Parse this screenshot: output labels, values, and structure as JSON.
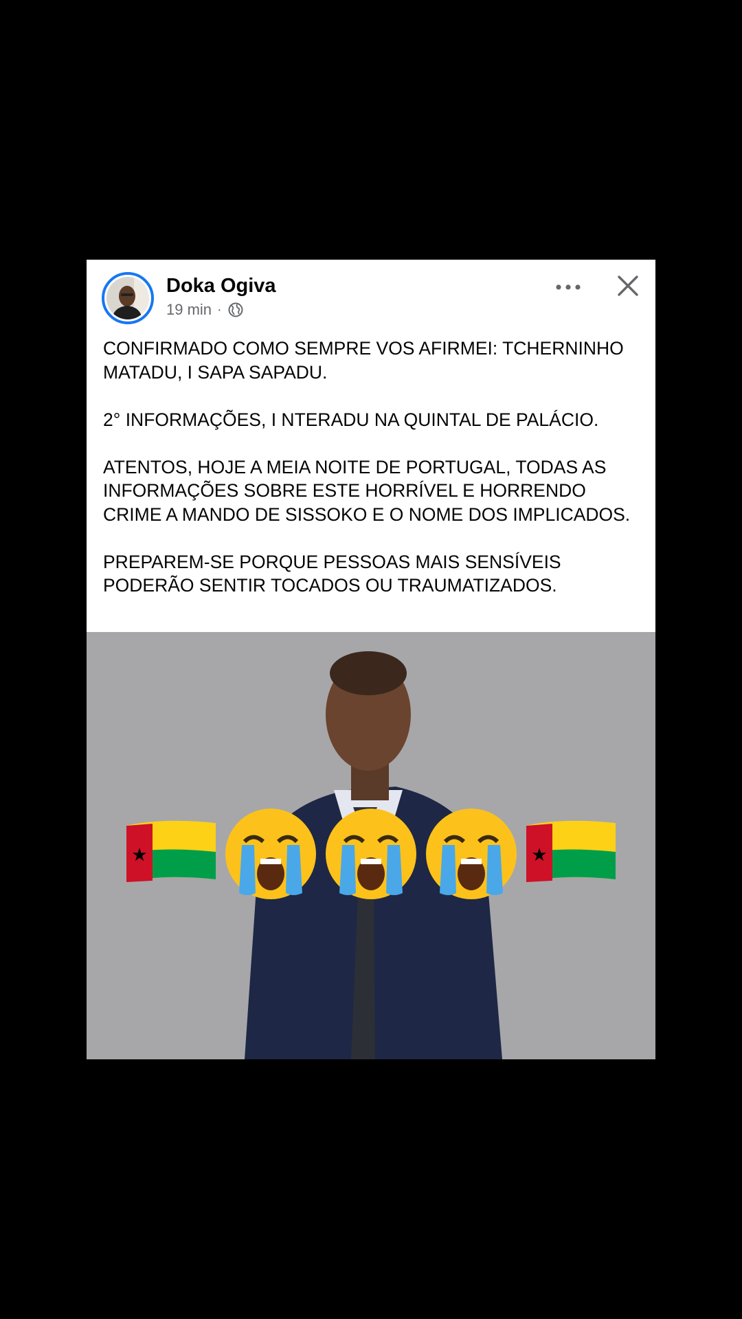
{
  "post": {
    "author": "Doka Ogiva",
    "time": "19 min",
    "separator": "·",
    "privacy_icon": "globe-icon",
    "paragraphs": [
      "CONFIRMADO COMO SEMPRE VOS AFIRMEI: TCHERNINHO MATADU, I SAPA SAPADU.",
      "2° INFORMAÇÕES, I NTERADU NA QUINTAL DE PALÁCIO.",
      "ATENTOS, HOJE A MEIA NOITE DE PORTUGAL, TODAS AS INFORMAÇÕES SOBRE ESTE HORRÍVEL E HORRENDO CRIME A MANDO DE SISSOKO E O NOME DOS IMPLICADOS.",
      "PREPAREM-SE PORQUE PESSOAS MAIS SENSÍVEIS PODERÃO SENTIR TOCADOS OU TRAUMATIZADOS."
    ]
  },
  "header_actions": {
    "more_icon": "more-horizontal-icon",
    "close_icon": "close-icon"
  },
  "image_overlay": {
    "emoji_row": [
      "flag-guinea-bissau",
      "loudly-crying-face",
      "loudly-crying-face",
      "loudly-crying-face",
      "flag-guinea-bissau"
    ]
  },
  "colors": {
    "background": "#000000",
    "card": "#ffffff",
    "avatar_ring": "#1877f2",
    "meta_text": "#65676b",
    "photo_bg": "#a7a7aa",
    "flag_red": "#ce1126",
    "flag_yellow": "#fcd116",
    "flag_green": "#009e49"
  }
}
